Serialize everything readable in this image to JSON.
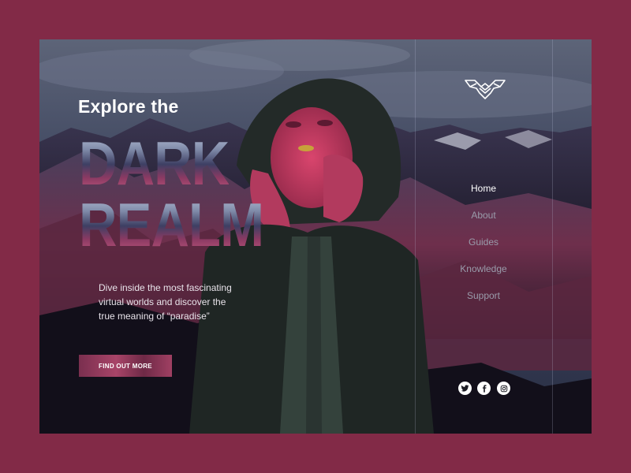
{
  "hero": {
    "headline_small": "Explore the",
    "headline_word1": "DARK",
    "headline_word2": "REALM",
    "description": "Dive inside the most fascinating virtual worlds and discover the true meaning of “paradise”",
    "cta_label": "FIND OUT MORE"
  },
  "nav": {
    "items": [
      {
        "label": "Home",
        "active": true
      },
      {
        "label": "About",
        "active": false
      },
      {
        "label": "Guides",
        "active": false
      },
      {
        "label": "Knowledge",
        "active": false
      },
      {
        "label": "Support",
        "active": false
      }
    ]
  },
  "brand": {
    "logo_icon": "geometric-wing-logo-icon"
  },
  "social": [
    {
      "name": "twitter",
      "icon": "twitter-icon"
    },
    {
      "name": "facebook",
      "icon": "facebook-icon"
    },
    {
      "name": "instagram",
      "icon": "instagram-icon"
    }
  ],
  "colors": {
    "page_background": "#822a47",
    "accent": "#a84468",
    "nav_active": "#ffffff",
    "nav_inactive": "#9a9cab"
  }
}
